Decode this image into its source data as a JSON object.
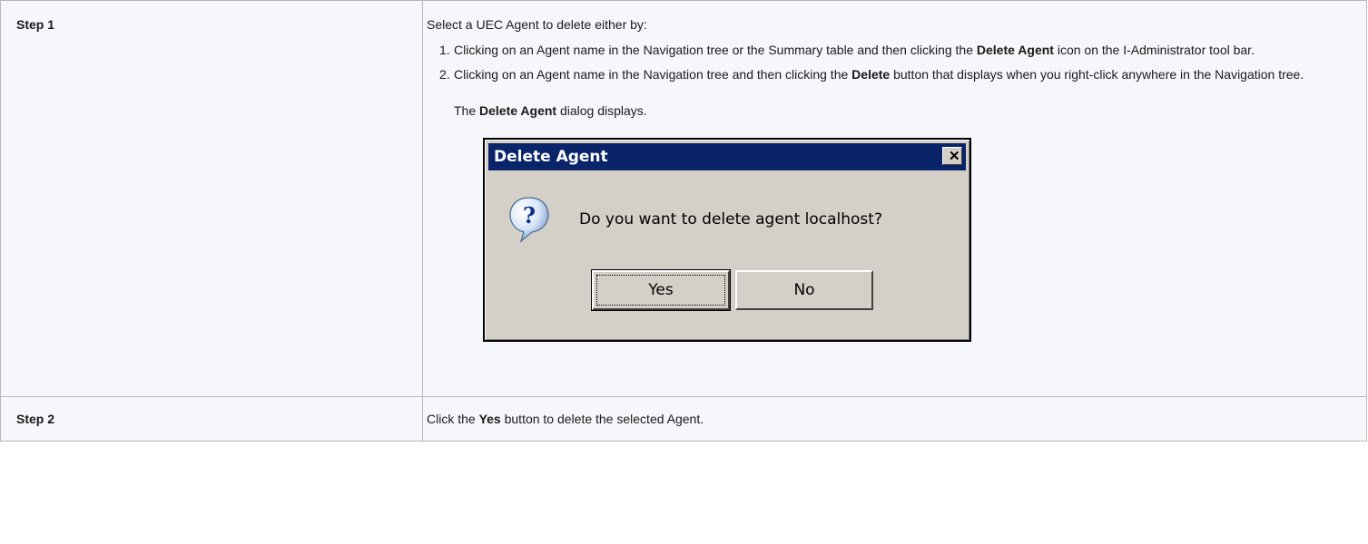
{
  "steps": [
    {
      "label": "Step 1",
      "intro": "Select a UEC Agent to delete either by:",
      "options": [
        {
          "number": "1.",
          "text_a": "Clicking on an Agent name in the Navigation tree or the Summary table and then clicking the ",
          "bold": "Delete Agent",
          "text_b": " icon on the I-Administrator tool bar."
        },
        {
          "number": "2.",
          "text_a": "Clicking on an Agent name in the Navigation tree and then clicking the ",
          "bold": "Delete",
          "text_b": " button that displays when you right-click anywhere in the Navigation tree."
        }
      ],
      "result_prefix": "The ",
      "result_bold": "Delete Agent",
      "result_suffix": " dialog displays."
    },
    {
      "label": "Step 2",
      "text_a": "Click the ",
      "bold": "Yes",
      "text_b": " button to delete the selected Agent."
    }
  ],
  "dialog": {
    "title": "Delete Agent",
    "close_glyph": "✕",
    "message": "Do you want to delete agent localhost?",
    "icon": "question-icon",
    "yes_label": "Yes",
    "no_label": "No",
    "colors": {
      "title_bar": "#0a246a",
      "face": "#d4d0c8"
    }
  }
}
